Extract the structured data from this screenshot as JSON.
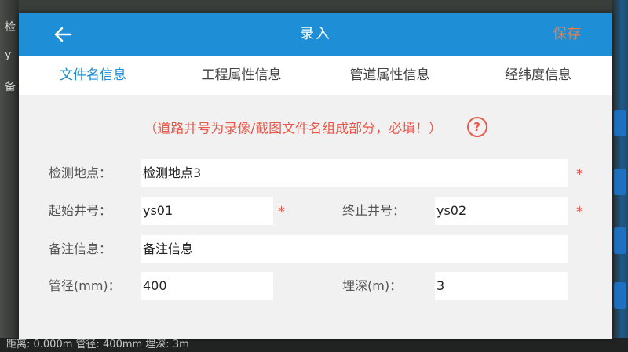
{
  "background": {
    "left_text": [
      "检",
      "y",
      "备"
    ],
    "bottom_text": "距离: 0.000m 管径: 400mm 埋深: 3m"
  },
  "dialog": {
    "title": "录入",
    "save_label": "保存",
    "back_icon": "arrow-left-icon",
    "tabs": [
      {
        "label": "文件名信息",
        "active": true
      },
      {
        "label": "工程属性信息",
        "active": false
      },
      {
        "label": "管道属性信息",
        "active": false
      },
      {
        "label": "经纬度信息",
        "active": false
      }
    ],
    "hint": "（道路井号为录像/截图文件名组成部分，必填！）",
    "help_icon": "?",
    "required_mark": "*",
    "form": {
      "location": {
        "label": "检测地点：",
        "value": "检测地点3"
      },
      "start_well": {
        "label": "起始井号：",
        "value": "ys01"
      },
      "end_well": {
        "label": "终止井号：",
        "value": "ys02"
      },
      "remark": {
        "label": "备注信息：",
        "value": "备注信息"
      },
      "diameter": {
        "label": "管径(mm)：",
        "value": "400"
      },
      "depth": {
        "label": "埋深(m)：",
        "value": "3"
      }
    }
  },
  "colors": {
    "primary": "#1e8fd6",
    "save": "#f07b3f",
    "required": "#e9584b"
  }
}
